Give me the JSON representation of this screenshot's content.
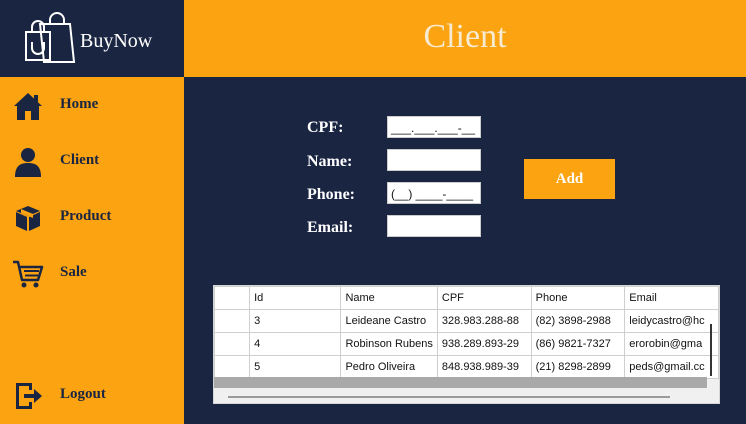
{
  "app": {
    "logo_text": "BuyNow"
  },
  "sidebar": {
    "items": [
      {
        "label": "Home",
        "icon": "home-icon"
      },
      {
        "label": "Client",
        "icon": "user-icon"
      },
      {
        "label": "Product",
        "icon": "box-icon"
      },
      {
        "label": "Sale",
        "icon": "cart-icon"
      }
    ],
    "logout_label": "Logout"
  },
  "header": {
    "title": "Client"
  },
  "form": {
    "cpf_label": "CPF:",
    "cpf_value": "___.___.___-__",
    "name_label": "Name:",
    "name_value": "",
    "phone_label": "Phone:",
    "phone_value": "(__) ____-____",
    "email_label": "Email:",
    "email_value": "",
    "add_label": "Add"
  },
  "grid": {
    "columns": [
      "Id",
      "Name",
      "CPF",
      "Phone",
      "Email"
    ],
    "rows": [
      [
        "3",
        "Leideane Castro",
        "328.983.288-88",
        "(82) 3898-2988",
        "leidycastro@hc"
      ],
      [
        "4",
        "Robinson Rubens",
        "938.289.893-29",
        "(86) 9821-7327",
        "erorobin@gma"
      ],
      [
        "5",
        "Pedro Oliveira",
        "848.938.989-39",
        "(21) 8298-2899",
        "peds@gmail.cc"
      ]
    ]
  },
  "colors": {
    "navy": "#1a2541",
    "orange": "#fba311",
    "title": "#f6ead0"
  }
}
